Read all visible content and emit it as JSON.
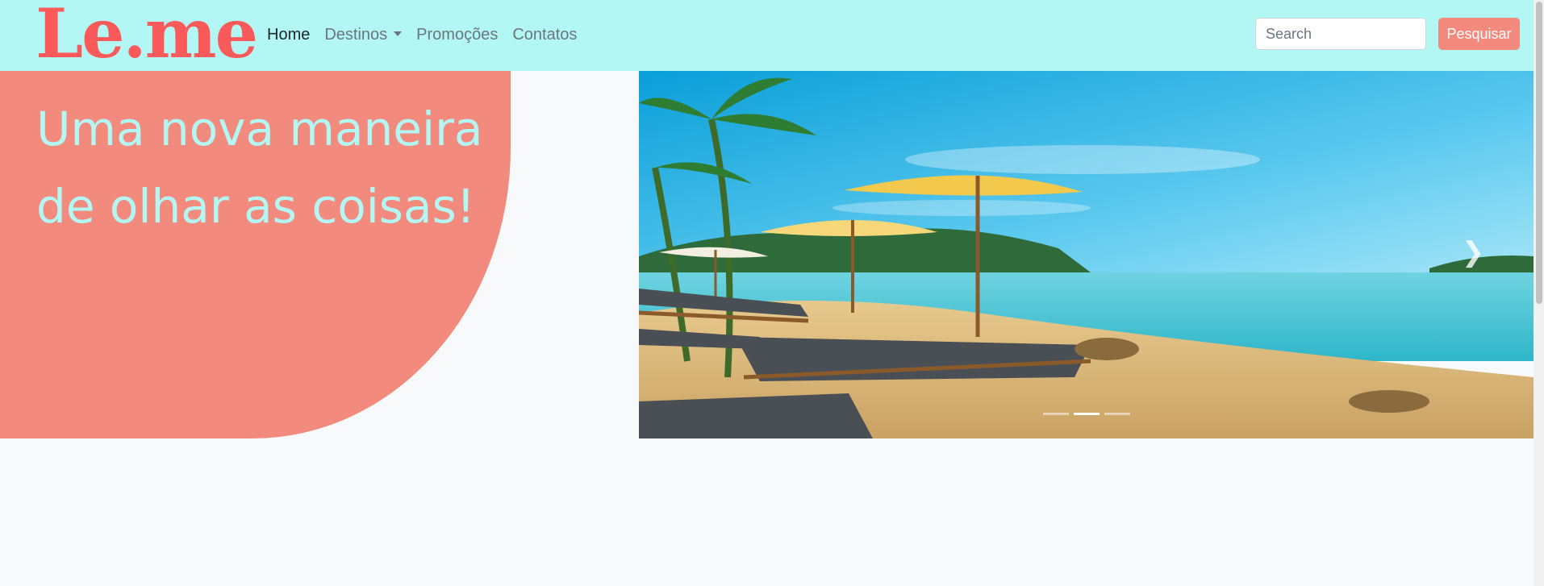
{
  "navbar": {
    "brand": "Le.me",
    "links": [
      {
        "label": "Home",
        "active": true
      },
      {
        "label": "Destinos",
        "dropdown": true
      },
      {
        "label": "Promoções"
      },
      {
        "label": "Contatos"
      }
    ],
    "search": {
      "placeholder": "Search",
      "value": ""
    },
    "search_button": "Pesquisar"
  },
  "hero": {
    "line1": "Uma nova maneira",
    "line2": "de olhar as coisas!"
  },
  "carousel": {
    "slides": 3,
    "active_slide": 2,
    "image": "beach-umbrellas-loungers",
    "next_icon": "chevron-right-icon"
  },
  "colors": {
    "navbar_bg": "#b2f7f4",
    "brand": "#fb5a5a",
    "accent": "#f28b7e",
    "hero_text": "#b2f7f4",
    "page_bg": "#f8f9fa"
  }
}
